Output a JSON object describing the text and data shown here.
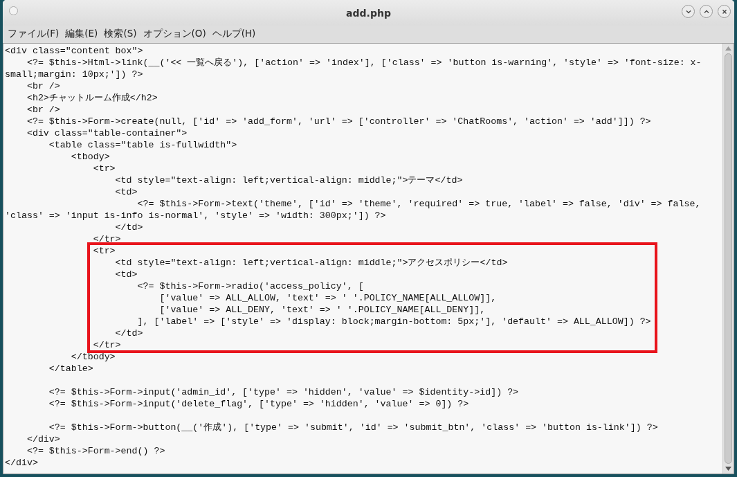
{
  "window": {
    "title": "add.php"
  },
  "menu": [
    {
      "label": "ファイル(F)"
    },
    {
      "label": "編集(E)"
    },
    {
      "label": "検索(S)"
    },
    {
      "label": "オプション(O)"
    },
    {
      "label": "ヘルプ(H)"
    }
  ],
  "editor": {
    "blocks": [
      {
        "highlighted": false,
        "lines": [
          {
            "kind": "code",
            "text": "<div class=\"content box\">"
          },
          {
            "kind": "code",
            "text": "    <?= $this->Html->link(__('<< 一覧へ戻る'), ['action' => 'index'], ['class' => 'button is-warning', 'style' => 'font-size: x-"
          },
          {
            "kind": "code",
            "text": "small;margin: 10px;']) ?>"
          },
          {
            "kind": "code",
            "text": "    <br />"
          },
          {
            "kind": "code",
            "text": "    <h2>チャットルーム作成</h2>"
          },
          {
            "kind": "code",
            "text": "    <br />"
          },
          {
            "kind": "code",
            "text": "    <?= $this->Form->create(null, ['id' => 'add_form', 'url' => ['controller' => 'ChatRooms', 'action' => 'add']]) ?>"
          },
          {
            "kind": "code",
            "text": "    <div class=\"table-container\">"
          },
          {
            "kind": "code",
            "text": "        <table class=\"table is-fullwidth\">"
          },
          {
            "kind": "code",
            "text": "            <tbody>"
          },
          {
            "kind": "code",
            "text": "                <tr>"
          },
          {
            "kind": "code",
            "text": "                    <td style=\"text-align: left;vertical-align: middle;\">テーマ</td>"
          },
          {
            "kind": "code",
            "text": "                    <td>"
          },
          {
            "kind": "code",
            "text": "                        <?= $this->Form->text('theme', ['id' => 'theme', 'required' => true, 'label' => false, 'div' => false,"
          },
          {
            "kind": "code",
            "text": "'class' => 'input is-info is-normal', 'style' => 'width: 300px;']) ?>"
          },
          {
            "kind": "code",
            "text": "                    </td>"
          },
          {
            "kind": "code",
            "text": "                </tr>"
          }
        ]
      },
      {
        "highlighted": true,
        "lines": [
          {
            "kind": "code",
            "text": "                <tr>"
          },
          {
            "kind": "code",
            "text": "                    <td style=\"text-align: left;vertical-align: middle;\">アクセスポリシー</td>"
          },
          {
            "kind": "code",
            "text": "                    <td>"
          },
          {
            "kind": "code",
            "text": "                        <?= $this->Form->radio('access_policy', ["
          },
          {
            "kind": "code",
            "text": "                            ['value' => ALL_ALLOW, 'text' => ' '.POLICY_NAME[ALL_ALLOW]],"
          },
          {
            "kind": "code",
            "text": "                            ['value' => ALL_DENY, 'text' => ' '.POLICY_NAME[ALL_DENY]],"
          },
          {
            "kind": "code",
            "text": "                        ], ['label' => ['style' => 'display: block;margin-bottom: 5px;'], 'default' => ALL_ALLOW]) ?>"
          },
          {
            "kind": "code",
            "text": "                    </td>"
          },
          {
            "kind": "code",
            "text": "                </tr>"
          }
        ]
      },
      {
        "highlighted": false,
        "lines": [
          {
            "kind": "code",
            "text": "            </tbody>"
          },
          {
            "kind": "code",
            "text": "        </table>"
          },
          {
            "kind": "blank"
          },
          {
            "kind": "code",
            "text": "        <?= $this->Form->input('admin_id', ['type' => 'hidden', 'value' => $identity->id]) ?>"
          },
          {
            "kind": "code",
            "text": "        <?= $this->Form->input('delete_flag', ['type' => 'hidden', 'value' => 0]) ?>"
          },
          {
            "kind": "blank"
          },
          {
            "kind": "code",
            "text": "        <?= $this->Form->button(__('作成'), ['type' => 'submit', 'id' => 'submit_btn', 'class' => 'button is-link']) ?>"
          },
          {
            "kind": "code",
            "text": "    </div>"
          },
          {
            "kind": "code",
            "text": "    <?= $this->Form->end() ?>"
          },
          {
            "kind": "code",
            "text": "</div>"
          }
        ]
      }
    ]
  }
}
